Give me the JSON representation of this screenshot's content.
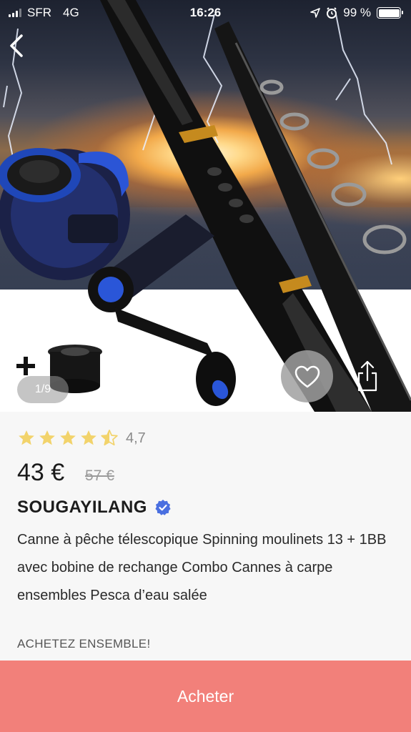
{
  "status_bar": {
    "carrier": "SFR",
    "network": "4G",
    "time": "16:26",
    "battery": "99 %"
  },
  "gallery": {
    "counter": "1/9"
  },
  "product": {
    "rating": "4,7",
    "rating_value": 4.7,
    "price": "43 €",
    "old_price": "57 €",
    "brand": "SOUGAYILANG",
    "title": "Canne à pêche télescopique Spinning moulinets 13 + 1BB avec bobine de rechange Combo Cannes à carpe ensembles Pesca d’eau salée",
    "section_label": "ACHETEZ ENSEMBLE!"
  },
  "actions": {
    "buy_label": "Acheter"
  },
  "colors": {
    "accent": "#f2807a",
    "star": "#f2d36b",
    "verified": "#4a6fe0"
  }
}
